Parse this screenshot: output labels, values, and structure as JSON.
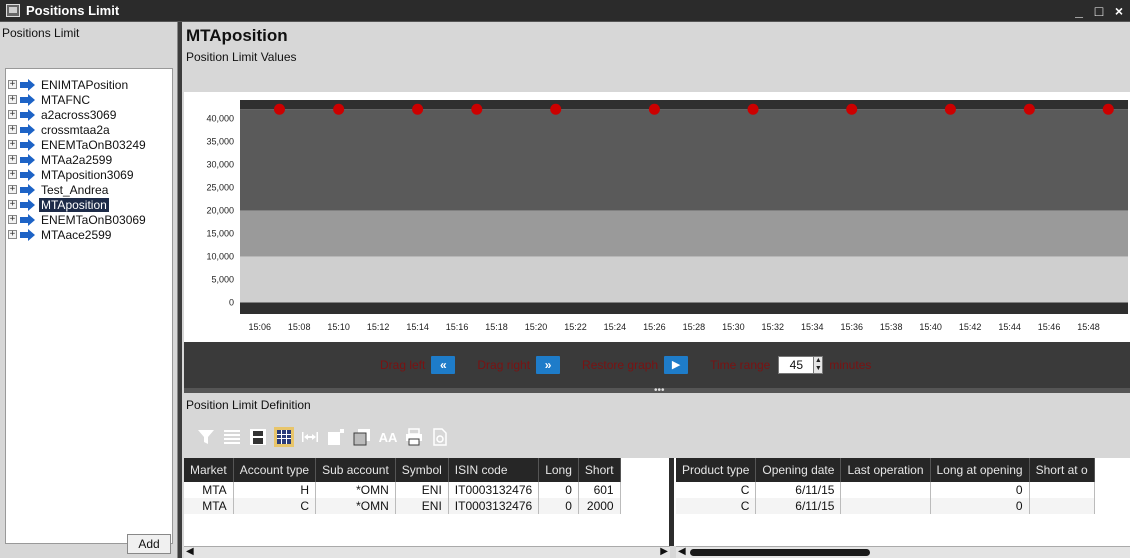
{
  "window": {
    "title": "Positions Limit",
    "controls": [
      "_",
      "□",
      "×"
    ]
  },
  "left_panel": {
    "header": "Positions Limit",
    "tree": [
      {
        "label": "ENIMTAPosition",
        "selected": false
      },
      {
        "label": "MTAFNC",
        "selected": false
      },
      {
        "label": "a2across3069",
        "selected": false
      },
      {
        "label": "crossmtaa2a",
        "selected": false
      },
      {
        "label": "ENEMTaOnB03249",
        "selected": false
      },
      {
        "label": "MTAa2a2599",
        "selected": false
      },
      {
        "label": "MTAposition3069",
        "selected": false
      },
      {
        "label": "Test_Andrea",
        "selected": false
      },
      {
        "label": "MTAposition",
        "selected": true
      },
      {
        "label": "ENEMTaOnB03069",
        "selected": false
      },
      {
        "label": "MTAace2599",
        "selected": false
      }
    ],
    "expander_symbol": "+",
    "add_button": "Add"
  },
  "main": {
    "title": "MTAposition",
    "values_label": "Position Limit Values",
    "definition_label": "Position Limit Definition"
  },
  "controls": {
    "drag_left_label": "Drag left",
    "drag_left_icon": "«",
    "drag_right_label": "Drag right",
    "drag_right_icon": "»",
    "restore_label": "Restore graph",
    "restore_icon": "▶",
    "time_range_label": "Time range",
    "time_range_value": "45",
    "time_range_unit": "minutes"
  },
  "toolbar_icons": [
    "filter-icon",
    "list-icon",
    "save-icon",
    "columns-icon",
    "fit-width-icon",
    "copy-icon",
    "copy-all-icon",
    "font-size-icon",
    "print-icon",
    "export-icon"
  ],
  "toolbar_font_glyph": "AA",
  "table_left": {
    "columns": [
      "Market",
      "Account type",
      "Sub account",
      "Symbol",
      "ISIN code",
      "Long",
      "Short"
    ],
    "rows": [
      [
        "MTA",
        "H",
        "*OMN",
        "ENI",
        "IT0003132476",
        "0",
        "601"
      ],
      [
        "MTA",
        "C",
        "*OMN",
        "ENI",
        "IT0003132476",
        "0",
        "2000"
      ]
    ]
  },
  "table_right": {
    "columns": [
      "Product type",
      "Opening date",
      "Last operation",
      "Long at opening",
      "Short at o"
    ],
    "rows": [
      [
        "C",
        "6/11/15",
        "",
        "0",
        ""
      ],
      [
        "C",
        "6/11/15",
        "",
        "0",
        ""
      ]
    ]
  },
  "colors": {
    "marker": "#cc0000",
    "band_dark": "#5a5a5a",
    "band_mid": "#9a9a9a",
    "band_light": "#cfcfcf",
    "band_edge": "#2f2f2f",
    "drag_text": "#7a1212",
    "drag_button": "#1e7cc9"
  },
  "chart_data": {
    "type": "scatter",
    "title": "",
    "xlabel": "",
    "ylabel": "",
    "x_ticks": [
      "15:06",
      "15:08",
      "15:10",
      "15:12",
      "15:14",
      "15:16",
      "15:18",
      "15:20",
      "15:22",
      "15:24",
      "15:26",
      "15:28",
      "15:30",
      "15:32",
      "15:34",
      "15:36",
      "15:38",
      "15:40",
      "15:42",
      "15:44",
      "15:46",
      "15:48"
    ],
    "y_ticks": [
      "0",
      "5,000",
      "10,000",
      "15,000",
      "20,000",
      "25,000",
      "30,000",
      "35,000",
      "40,000"
    ],
    "ylim": [
      -2500,
      44000
    ],
    "bands": [
      {
        "from": -2500,
        "to": 0,
        "color": "#2f2f2f"
      },
      {
        "from": 0,
        "to": 10000,
        "color": "#cfcfcf"
      },
      {
        "from": 10000,
        "to": 20000,
        "color": "#9a9a9a"
      },
      {
        "from": 20000,
        "to": 42000,
        "color": "#5a5a5a"
      },
      {
        "from": 42000,
        "to": 44000,
        "color": "#2f2f2f"
      }
    ],
    "points_x": [
      "15:07",
      "15:10",
      "15:14",
      "15:17",
      "15:21",
      "15:26",
      "15:31",
      "15:36",
      "15:41",
      "15:45",
      "15:49"
    ],
    "points_y": 42000
  }
}
